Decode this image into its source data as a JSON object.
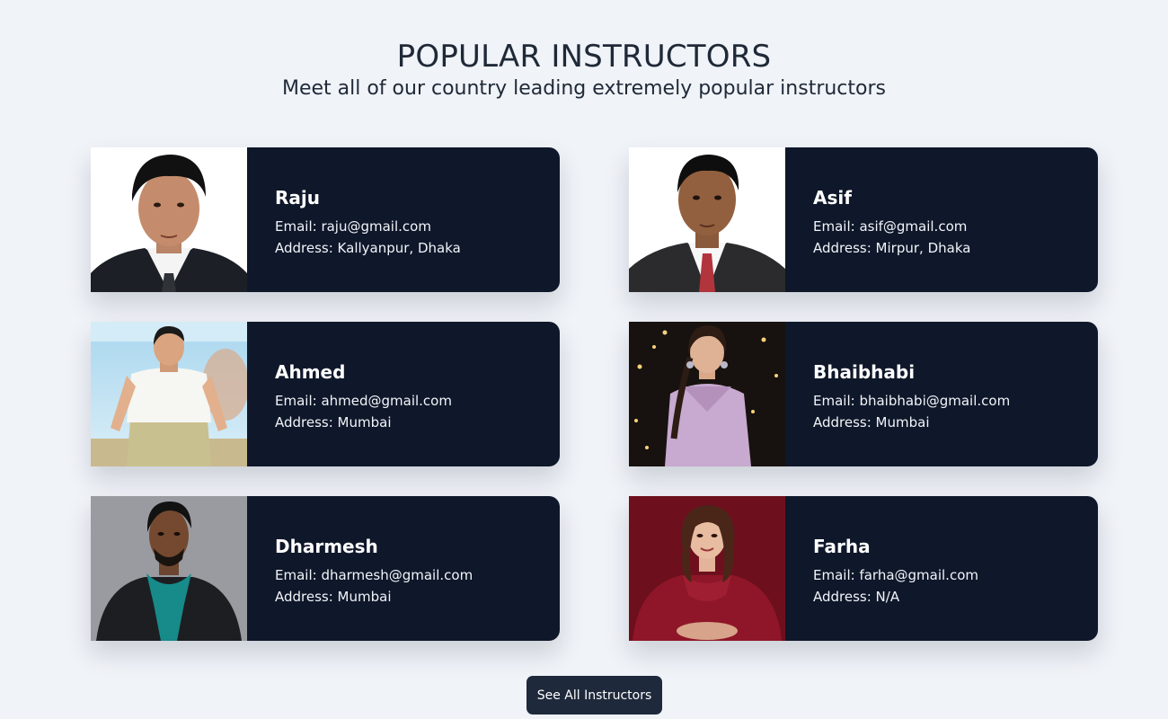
{
  "section": {
    "title": "POPULAR INSTRUCTORS",
    "subtitle": "Meet all of our country leading extremely popular instructors"
  },
  "instructors": [
    {
      "name": "Raju",
      "email": "Email: raju@gmail.com",
      "address": "Address: Kallyanpur, Dhaka",
      "photo_icon": "person-photo-suit"
    },
    {
      "name": "Asif",
      "email": "Email: asif@gmail.com",
      "address": "Address: Mirpur, Dhaka",
      "photo_icon": "person-photo-suit-tie"
    },
    {
      "name": "Ahmed",
      "email": "Email: ahmed@gmail.com",
      "address": "Address: Mumbai",
      "photo_icon": "person-photo-poster"
    },
    {
      "name": "Bhaibhabi",
      "email": "Email: bhaibhabi@gmail.com",
      "address": "Address: Mumbai",
      "photo_icon": "person-photo-stage"
    },
    {
      "name": "Dharmesh",
      "email": "Email: dharmesh@gmail.com",
      "address": "Address: Mumbai",
      "photo_icon": "person-photo-scarf"
    },
    {
      "name": "Farha",
      "email": "Email: farha@gmail.com",
      "address": "Address: N/A",
      "photo_icon": "person-photo-maroon"
    }
  ],
  "actions": {
    "see_all_label": "See All Instructors"
  },
  "colors": {
    "page_background": "#f0f3f8",
    "card_background": "#0f172a",
    "button_background": "#1e293b",
    "text_dark": "#1f2937"
  }
}
